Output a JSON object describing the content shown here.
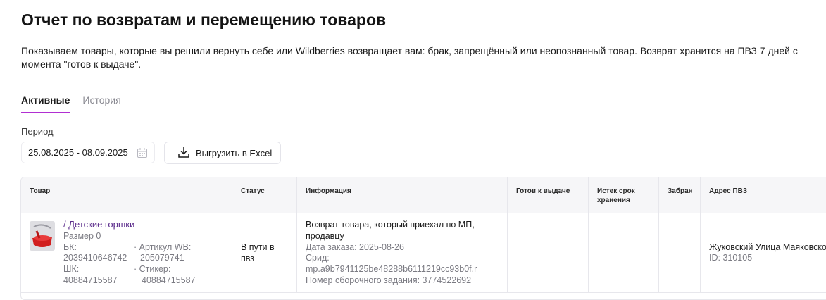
{
  "page": {
    "title": "Отчет по возвратам и перемещению товаров",
    "description": "Показываем товары, которые вы решили вернуть себе или Wildberries возвращает вам: брак, запрещённый или неопознанный товар. Возврат хранится на ПВЗ 7 дней с момента \"готов к выдаче\"."
  },
  "tabs": [
    {
      "label": "Активные",
      "active": true
    },
    {
      "label": "История",
      "active": false
    }
  ],
  "filters": {
    "period_label": "Период",
    "period_value": "25.08.2025 - 08.09.2025",
    "export_label": "Выгрузить в Excel"
  },
  "table": {
    "headers": {
      "product": "Товар",
      "status": "Статус",
      "info": "Информация",
      "ready": "Готов к выдаче",
      "expiry": "Истек срок хранения",
      "taken": "Забран",
      "address": "Адрес ПВЗ"
    },
    "row": {
      "product_name": "/ Детские горшки",
      "size": "Размер 0",
      "bk_label": "БК:",
      "bk_value": "2039410646742",
      "article_label": "· Артикул WB:",
      "article_value": "205079741",
      "shk_label": "ШК:",
      "shk_value": "40884715587",
      "sticker_label": "· Стикер:",
      "sticker_value": "40884715587",
      "status": "В пути в пвз",
      "info_title": "Возврат товара, который приехал по МП, продавцу",
      "order_date": "Дата заказа: 2025-08-26",
      "srid_label": "Срид:",
      "srid_value": "mp.a9b7941125be48288b6111219cc93b0f.r",
      "assembly": "Номер сборочного задания: 3774522692",
      "ready": "",
      "expiry": "",
      "taken": "",
      "address": "Жуковский Улица Маяковского",
      "address_id": "ID: 310105"
    }
  },
  "colors": {
    "accent": "#b12fd2",
    "link": "#5c2d8c",
    "header_bg": "#f6f6f8"
  },
  "icons": [
    "calendar-icon",
    "download-icon"
  ]
}
